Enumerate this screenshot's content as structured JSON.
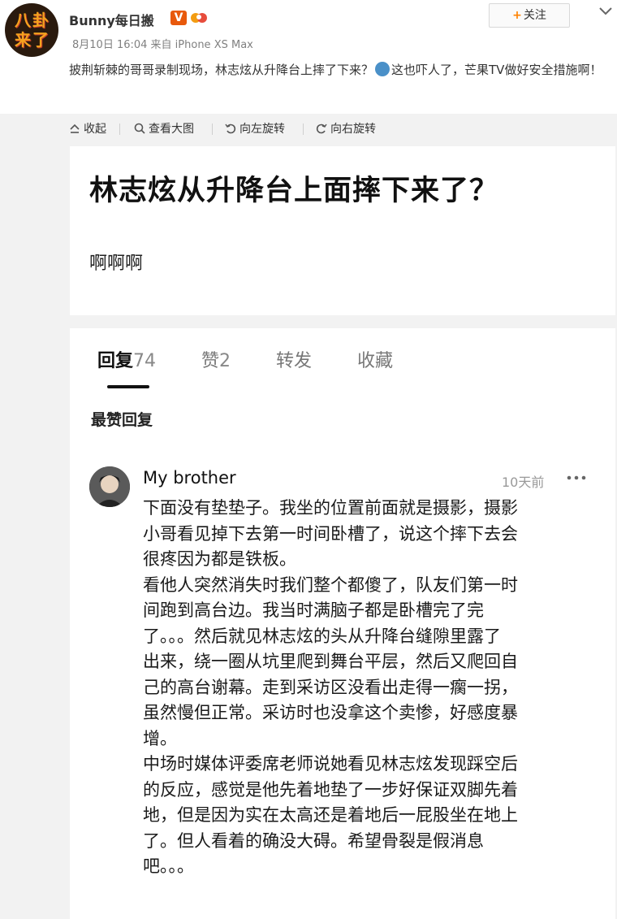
{
  "post": {
    "username": "Bunny每日搬",
    "verified_badge": "V",
    "avatar_text_line1": "八卦",
    "avatar_text_line2": "来了",
    "meta": "8月10日 16:04 来自 iPhone XS Max",
    "follow_label": "关注",
    "text_part1": "披荆斩棘的哥哥录制现场，林志炫从升降台上摔了下来？",
    "text_part2": "这也吓人了，芒果TV做好安全措施啊！",
    "icons": {
      "follow": "plus-icon",
      "menu": "chevron-down-icon",
      "emoji": "scared-emoji-icon"
    }
  },
  "toolbar": {
    "collapse": "收起",
    "view_large": "查看大图",
    "rotate_left": "向左旋转",
    "rotate_right": "向右旋转"
  },
  "screenshot": {
    "title": "林志炫从升降台上面摔下来了？",
    "subtext": "啊啊啊",
    "tabs": [
      {
        "label": "回复",
        "count": "74",
        "active": true
      },
      {
        "label": "赞",
        "count": "2",
        "active": false
      },
      {
        "label": "转发",
        "count": "",
        "active": false
      },
      {
        "label": "收藏",
        "count": "",
        "active": false
      }
    ],
    "section_title": "最赞回复",
    "comment": {
      "author": "My brother",
      "time": "10天前",
      "lines": [
        "下面没有垫垫子。我坐的位置前面就是摄影，摄影",
        "小哥看见掉下去第一时间卧槽了，说这个摔下去会",
        "很疼因为都是铁板。",
        "看他人突然消失时我们整个都傻了，队友们第一时",
        "间跑到高台边。我当时满脑子都是卧槽完了完",
        "了。。。然后就见林志炫的头从升降台缝隙里露了",
        "出来，绕一圈从坑里爬到舞台平层，然后又爬回自",
        "己的高台谢幕。走到采访区没看出走得一瘸一拐，",
        "虽然慢但正常。采访时也没拿这个卖惨，好感度暴",
        "增。",
        "中场时媒体评委席老师说她看见林志炫发现踩空后",
        "的反应，感觉是他先着地垫了一步好保证双脚先着",
        "地，但是因为实在太高还是着地后一屁股坐在地上",
        "了。但人看着的确没大碍。希望骨裂是假消息",
        "吧。。。"
      ]
    }
  },
  "colors": {
    "accent_orange": "#ff8200",
    "verified_orange": "#e8590c",
    "background": "#f2f2f2"
  }
}
